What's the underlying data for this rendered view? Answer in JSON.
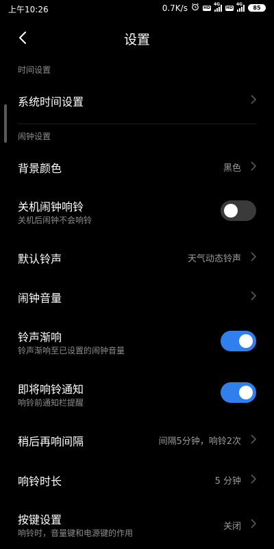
{
  "status_bar": {
    "time": "上午10:26",
    "net_speed": "0.7K/s",
    "hd_label": "HD",
    "net_type": "4G",
    "battery": "85"
  },
  "header": {
    "title": "设置",
    "back_icon": "chevron-left-icon"
  },
  "sections": {
    "time": "时间设置",
    "alarm": "闹钟设置"
  },
  "rows": {
    "system_time": {
      "title": "系统时间设置"
    },
    "background_color": {
      "title": "背景颜色",
      "value": "黑色"
    },
    "power_off_alarm": {
      "title": "关机闹钟响铃",
      "subtitle": "关机后闹钟不会响铃",
      "on": false
    },
    "default_ringtone": {
      "title": "默认铃声",
      "value": "天气动态铃声"
    },
    "alarm_volume": {
      "title": "闹钟音量"
    },
    "fade_in": {
      "title": "铃声渐响",
      "subtitle": "铃声渐响至已设置的闹钟音量",
      "on": true
    },
    "upcoming_notice": {
      "title": "即将响铃通知",
      "subtitle": "响铃前通知栏提醒",
      "on": true
    },
    "snooze_interval": {
      "title": "稍后再响间隔",
      "value": "间隔5分钟，响铃2次"
    },
    "ring_duration": {
      "title": "响铃时长",
      "value": "5 分钟"
    },
    "button_settings": {
      "title": "按键设置",
      "subtitle": "响铃时，音量键和电源键的作用",
      "value": "关闭"
    }
  },
  "colors": {
    "background": "#000000",
    "toggle_on": "#2f80ed",
    "toggle_off": "#3a3a3a",
    "secondary_text": "#8c8c8c"
  }
}
